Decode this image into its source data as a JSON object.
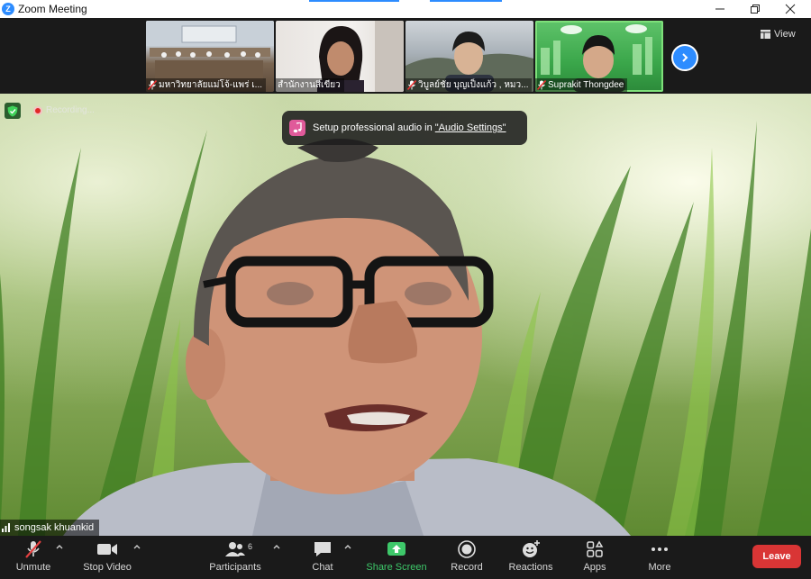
{
  "window": {
    "title": "Zoom Meeting"
  },
  "thumbnails": [
    {
      "name": "มหาวิทยาลัยแม่โจ้-แพร่ เ...",
      "muted": true,
      "active": false
    },
    {
      "name": "สำนักงานสีเขียว",
      "muted": false,
      "active": false
    },
    {
      "name": "วิบูลย์ชัย บุญเป็งแก้ว , หมว...",
      "muted": true,
      "active": false
    },
    {
      "name": "Suprakit Thongdee",
      "muted": true,
      "active": true
    }
  ],
  "view": {
    "label": "View"
  },
  "recording": {
    "label": "Recording..."
  },
  "toast": {
    "prefix": "Setup professional audio in ",
    "link": "\"Audio Settings\""
  },
  "speaker": {
    "name": "songsak khuankid"
  },
  "toolbar": {
    "unmute": "Unmute",
    "stop_video": "Stop Video",
    "participants": "Participants",
    "participants_count": "6",
    "chat": "Chat",
    "share_screen": "Share Screen",
    "record": "Record",
    "reactions": "Reactions",
    "apps": "Apps",
    "more": "More",
    "leave": "Leave"
  },
  "colors": {
    "accent": "#2d8cff",
    "share_green": "#3ec86a",
    "leave_red": "#d93535",
    "active_speaker": "#7ee07a"
  }
}
